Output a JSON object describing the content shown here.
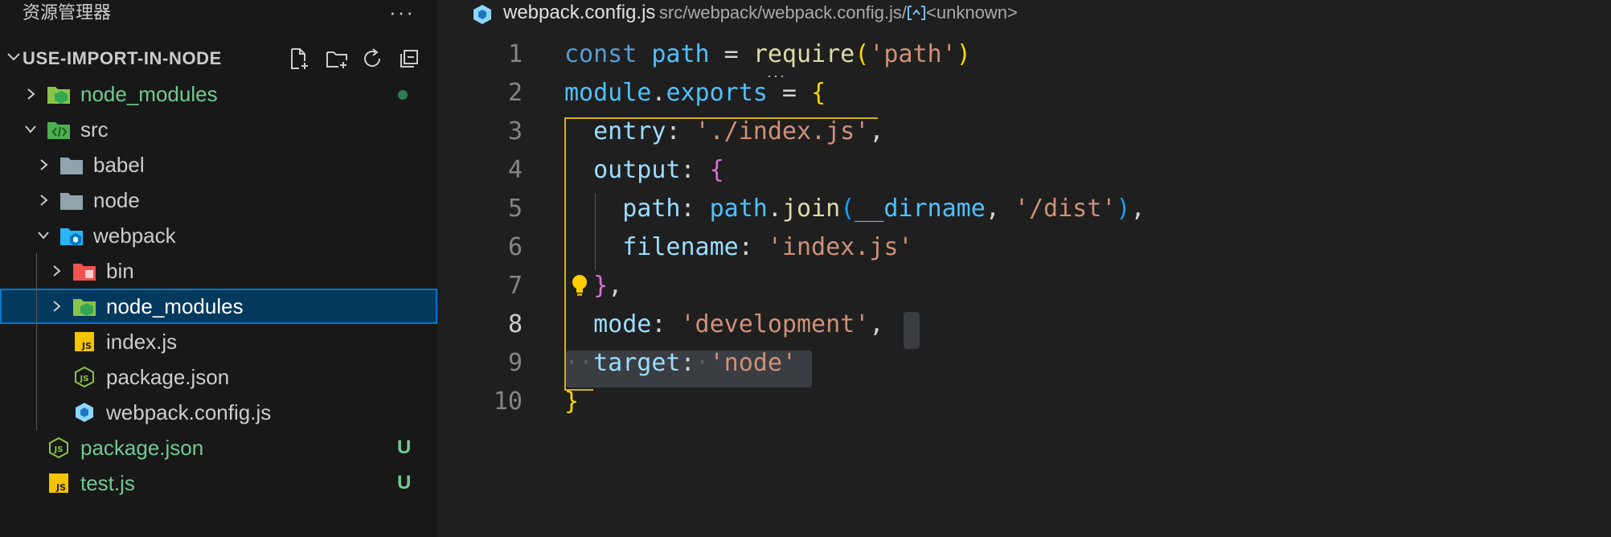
{
  "explorer": {
    "title": "资源管理器",
    "more": "···",
    "folder": "USE-IMPORT-IN-NODE",
    "tree": [
      {
        "label": "node_modules",
        "depth": 0,
        "kind": "folder-node",
        "expanded": false,
        "color": "green",
        "decoration": "dot"
      },
      {
        "label": "src",
        "depth": 0,
        "kind": "folder-src",
        "expanded": true,
        "color": "default"
      },
      {
        "label": "babel",
        "depth": 1,
        "kind": "folder",
        "expanded": false,
        "color": "default"
      },
      {
        "label": "node",
        "depth": 1,
        "kind": "folder",
        "expanded": false,
        "color": "default"
      },
      {
        "label": "webpack",
        "depth": 1,
        "kind": "folder-webpack",
        "expanded": true,
        "color": "default"
      },
      {
        "label": "bin",
        "depth": 2,
        "kind": "folder-bin",
        "expanded": false,
        "color": "default"
      },
      {
        "label": "node_modules",
        "depth": 2,
        "kind": "folder-node",
        "expanded": false,
        "color": "default",
        "selected": true
      },
      {
        "label": "index.js",
        "depth": 2,
        "kind": "file-js",
        "color": "default"
      },
      {
        "label": "package.json",
        "depth": 2,
        "kind": "file-node",
        "color": "default"
      },
      {
        "label": "webpack.config.js",
        "depth": 2,
        "kind": "file-webpack",
        "color": "default"
      },
      {
        "label": "package.json",
        "depth": 0,
        "kind": "file-node",
        "color": "green",
        "badge": "U"
      },
      {
        "label": "test.js",
        "depth": 0,
        "kind": "file-js",
        "color": "green",
        "badge": "U"
      }
    ]
  },
  "editor": {
    "breadcrumb": {
      "file": "webpack.config.js",
      "path": "src/webpack/webpack.config.js/",
      "symbol": "<unknown>"
    },
    "active_line": 8,
    "lines": [
      {
        "n": "1",
        "tokens": [
          [
            "kw",
            "const"
          ],
          [
            "pun",
            " "
          ],
          [
            "var",
            "path"
          ],
          [
            "pun",
            " = "
          ],
          [
            "fn",
            "require"
          ],
          [
            "b1",
            "("
          ],
          [
            "str",
            "'path'"
          ],
          [
            "b1",
            ")"
          ]
        ]
      },
      {
        "n": "2",
        "tokens": [
          [
            "var",
            "module"
          ],
          [
            "pun",
            "."
          ],
          [
            "var",
            "exports"
          ],
          [
            "pun",
            " = "
          ],
          [
            "b1",
            "{"
          ]
        ]
      },
      {
        "n": "3",
        "tokens": [
          [
            "pun",
            "  "
          ],
          [
            "prop",
            "entry"
          ],
          [
            "pun",
            ": "
          ],
          [
            "str",
            "'./index.js'"
          ],
          [
            "pun",
            ","
          ]
        ]
      },
      {
        "n": "4",
        "tokens": [
          [
            "pun",
            "  "
          ],
          [
            "prop",
            "output"
          ],
          [
            "pun",
            ": "
          ],
          [
            "b2",
            "{"
          ]
        ]
      },
      {
        "n": "5",
        "tokens": [
          [
            "pun",
            "    "
          ],
          [
            "prop",
            "path"
          ],
          [
            "pun",
            ": "
          ],
          [
            "var",
            "path"
          ],
          [
            "pun",
            "."
          ],
          [
            "fn",
            "join"
          ],
          [
            "b3",
            "("
          ],
          [
            "var",
            "__dirname"
          ],
          [
            "pun",
            ", "
          ],
          [
            "str",
            "'/dist'"
          ],
          [
            "b3",
            ")"
          ],
          [
            "pun",
            ","
          ]
        ]
      },
      {
        "n": "6",
        "tokens": [
          [
            "pun",
            "    "
          ],
          [
            "prop",
            "filename"
          ],
          [
            "pun",
            ": "
          ],
          [
            "str",
            "'index.js'"
          ]
        ]
      },
      {
        "n": "7",
        "tokens": [
          [
            "pun",
            "  "
          ],
          [
            "b2",
            "}"
          ],
          [
            "pun",
            ","
          ]
        ]
      },
      {
        "n": "8",
        "tokens": [
          [
            "pun",
            "  "
          ],
          [
            "prop",
            "mode"
          ],
          [
            "pun",
            ": "
          ],
          [
            "str",
            "'development'"
          ],
          [
            "pun",
            ","
          ]
        ]
      },
      {
        "n": "9",
        "tokens": [
          [
            "ws",
            "··"
          ],
          [
            "prop",
            "target"
          ],
          [
            "pun",
            ":"
          ],
          [
            "ws",
            "·"
          ],
          [
            "str",
            "'node'"
          ]
        ]
      },
      {
        "n": "10",
        "tokens": [
          [
            "b1",
            "}"
          ]
        ]
      }
    ]
  }
}
